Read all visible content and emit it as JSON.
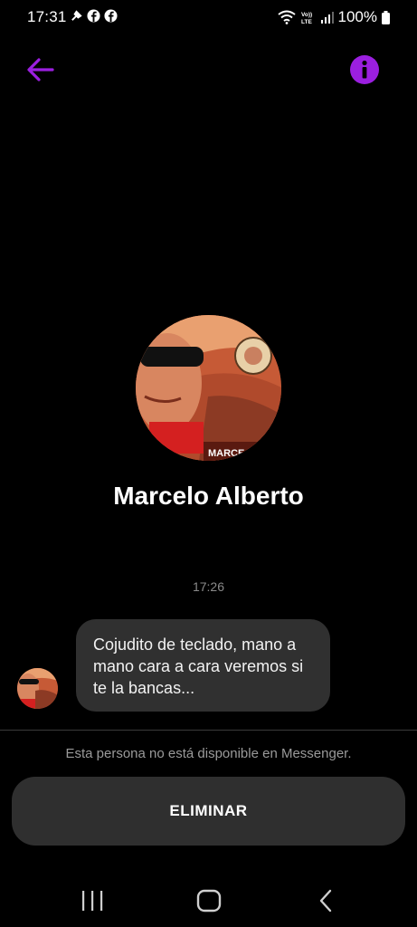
{
  "status_bar": {
    "time": "17:31",
    "battery": "100%",
    "left_icons": [
      "tool-icon",
      "facebook-icon",
      "facebook-icon"
    ],
    "right_icons": [
      "wifi-icon",
      "volte-icon",
      "signal-icon",
      "battery-icon"
    ]
  },
  "header": {
    "back_icon": "arrow-left-icon",
    "info_icon": "info-icon"
  },
  "profile": {
    "name": "Marcelo Alberto"
  },
  "conversation": {
    "timestamp": "17:26",
    "messages": [
      {
        "text": "Cojudito de teclado, mano a mano cara a cara veremos si te la bancas..."
      }
    ]
  },
  "footer": {
    "unavailable_text": "Esta persona no está disponible en Messenger.",
    "delete_label": "ELIMINAR"
  },
  "colors": {
    "accent": "#9b1fe0",
    "background": "#000000",
    "bubble": "#303030",
    "button": "#2f2f2f"
  }
}
